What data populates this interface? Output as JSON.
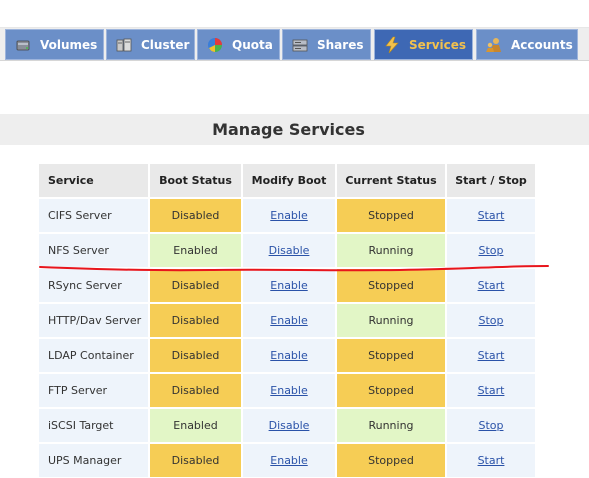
{
  "colors": {
    "tab_bg": "#6b8fc8",
    "tab_active_bg": "#3e68b4",
    "tab_active_text": "#f2c14e",
    "status_warn": "#f6cd55",
    "status_ok": "#e2f6c6",
    "link": "#2a52a8",
    "annotation": "#e8151c"
  },
  "nav": {
    "tabs": [
      {
        "label": "Volumes",
        "icon": "volumes-icon"
      },
      {
        "label": "Cluster",
        "icon": "cluster-icon"
      },
      {
        "label": "Quota",
        "icon": "quota-icon"
      },
      {
        "label": "Shares",
        "icon": "shares-icon"
      },
      {
        "label": "Services",
        "icon": "services-icon",
        "active": true
      },
      {
        "label": "Accounts",
        "icon": "accounts-icon"
      }
    ]
  },
  "page": {
    "title": "Manage Services"
  },
  "table": {
    "headers": [
      "Service",
      "Boot Status",
      "Modify Boot",
      "Current Status",
      "Start / Stop"
    ],
    "rows": [
      {
        "service": "CIFS Server",
        "boot_status": "Disabled",
        "modify_boot": "Enable",
        "current_status": "Stopped",
        "action": "Start"
      },
      {
        "service": "NFS Server",
        "boot_status": "Enabled",
        "modify_boot": "Disable",
        "current_status": "Running",
        "action": "Stop"
      },
      {
        "service": "RSync Server",
        "boot_status": "Disabled",
        "modify_boot": "Enable",
        "current_status": "Stopped",
        "action": "Start"
      },
      {
        "service": "HTTP/Dav Server",
        "boot_status": "Disabled",
        "modify_boot": "Enable",
        "current_status": "Running",
        "action": "Stop"
      },
      {
        "service": "LDAP Container",
        "boot_status": "Disabled",
        "modify_boot": "Enable",
        "current_status": "Stopped",
        "action": "Start"
      },
      {
        "service": "FTP Server",
        "boot_status": "Disabled",
        "modify_boot": "Enable",
        "current_status": "Stopped",
        "action": "Start"
      },
      {
        "service": "iSCSI Target",
        "boot_status": "Enabled",
        "modify_boot": "Disable",
        "current_status": "Running",
        "action": "Stop"
      },
      {
        "service": "UPS Manager",
        "boot_status": "Disabled",
        "modify_boot": "Enable",
        "current_status": "Stopped",
        "action": "Start"
      }
    ]
  }
}
